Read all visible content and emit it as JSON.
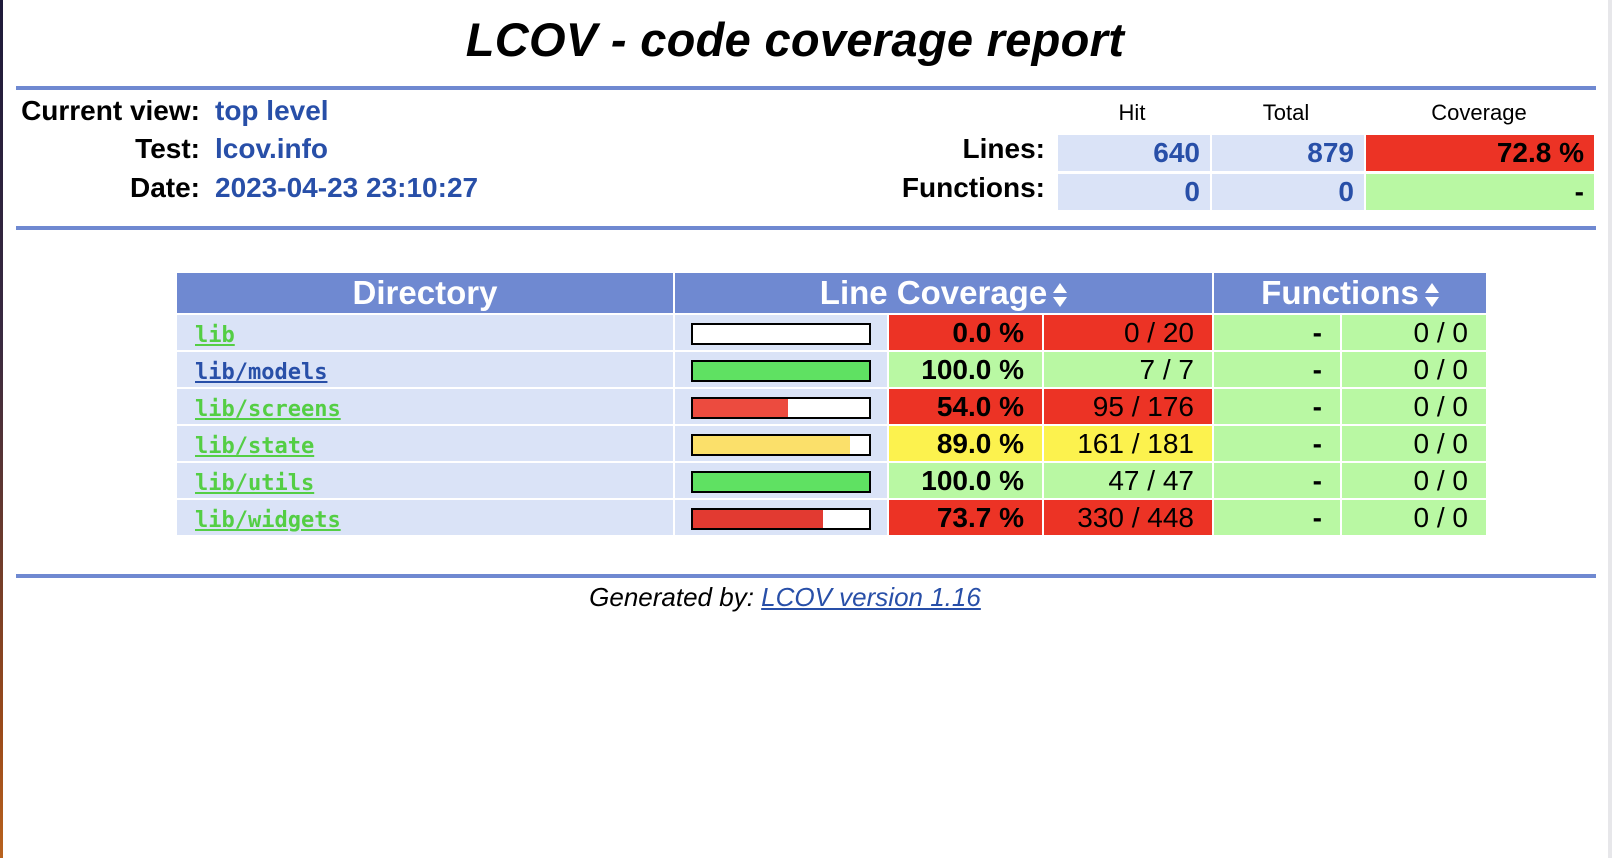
{
  "page_title": "LCOV - code coverage report",
  "header": {
    "current_view_label": "Current view:",
    "current_view_value": "top level",
    "test_label": "Test:",
    "test_value": "lcov.info",
    "date_label": "Date:",
    "date_value": "2023-04-23 23:10:27"
  },
  "summary": {
    "col_hit": "Hit",
    "col_total": "Total",
    "col_coverage": "Coverage",
    "lines_label": "Lines:",
    "lines_hit": "640",
    "lines_total": "879",
    "lines_coverage": "72.8 %",
    "functions_label": "Functions:",
    "functions_hit": "0",
    "functions_total": "0",
    "functions_coverage": "-"
  },
  "table": {
    "col_directory": "Directory",
    "col_line_coverage": "Line Coverage",
    "col_functions": "Functions",
    "rows": [
      {
        "name": "lib",
        "bar_fraction": 0.0,
        "bar_color": "#ec3325",
        "status": "red",
        "percent": "0.0 %",
        "count": "0 / 20",
        "fn_percent": "-",
        "fn_count": "0 / 0"
      },
      {
        "name": "lib/models",
        "bar_fraction": 1.0,
        "bar_color": "#5fe162",
        "status": "green",
        "percent": "100.0 %",
        "count": "7 / 7",
        "fn_percent": "-",
        "fn_count": "0 / 0"
      },
      {
        "name": "lib/screens",
        "bar_fraction": 0.54,
        "bar_color": "#ec4b3f",
        "status": "red",
        "percent": "54.0 %",
        "count": "95 / 176",
        "fn_percent": "-",
        "fn_count": "0 / 0"
      },
      {
        "name": "lib/state",
        "bar_fraction": 0.89,
        "bar_color": "#fbe06a",
        "status": "yellow",
        "percent": "89.0 %",
        "count": "161 / 181",
        "fn_percent": "-",
        "fn_count": "0 / 0"
      },
      {
        "name": "lib/utils",
        "bar_fraction": 1.0,
        "bar_color": "#5fe162",
        "status": "green",
        "percent": "100.0 %",
        "count": "47 / 47",
        "fn_percent": "-",
        "fn_count": "0 / 0"
      },
      {
        "name": "lib/widgets",
        "bar_fraction": 0.737,
        "bar_color": "#e23a31",
        "status": "red",
        "percent": "73.7 %",
        "count": "330 / 448",
        "fn_percent": "-",
        "fn_count": "0 / 0"
      }
    ]
  },
  "footer": {
    "prefix": "Generated by: ",
    "link_text": "LCOV version 1.16"
  },
  "colors": {
    "header_blue": "#6f89d1",
    "cell_blue": "#dae3f7",
    "red": "#ec3325",
    "green": "#b9f8a3",
    "yellow": "#fcf24e",
    "link_blue": "#284fa8"
  }
}
